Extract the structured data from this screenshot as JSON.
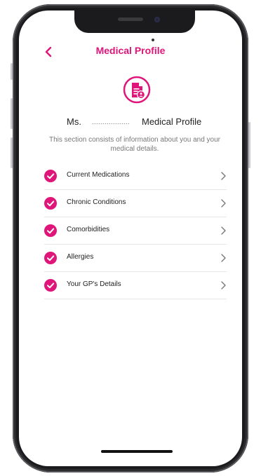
{
  "header": {
    "title": "Medical Profile",
    "back_icon": "chevron-left-icon"
  },
  "profile": {
    "icon": "medical-document-icon",
    "salutation": "Ms.",
    "name_placeholder": "..................",
    "suffix": "Medical Profile",
    "description": "This section consists of information about you and your medical details."
  },
  "menu": {
    "items": [
      {
        "label": "Current Medications",
        "checked": true
      },
      {
        "label": "Chronic Conditions",
        "checked": true
      },
      {
        "label": "Comorbidities",
        "checked": true
      },
      {
        "label": "Allergies",
        "checked": true
      },
      {
        "label": "Your GP's Details",
        "checked": true
      }
    ]
  },
  "colors": {
    "accent": "#e0157a",
    "text": "#222222",
    "muted": "#777777",
    "divider": "#e6e6e6"
  }
}
